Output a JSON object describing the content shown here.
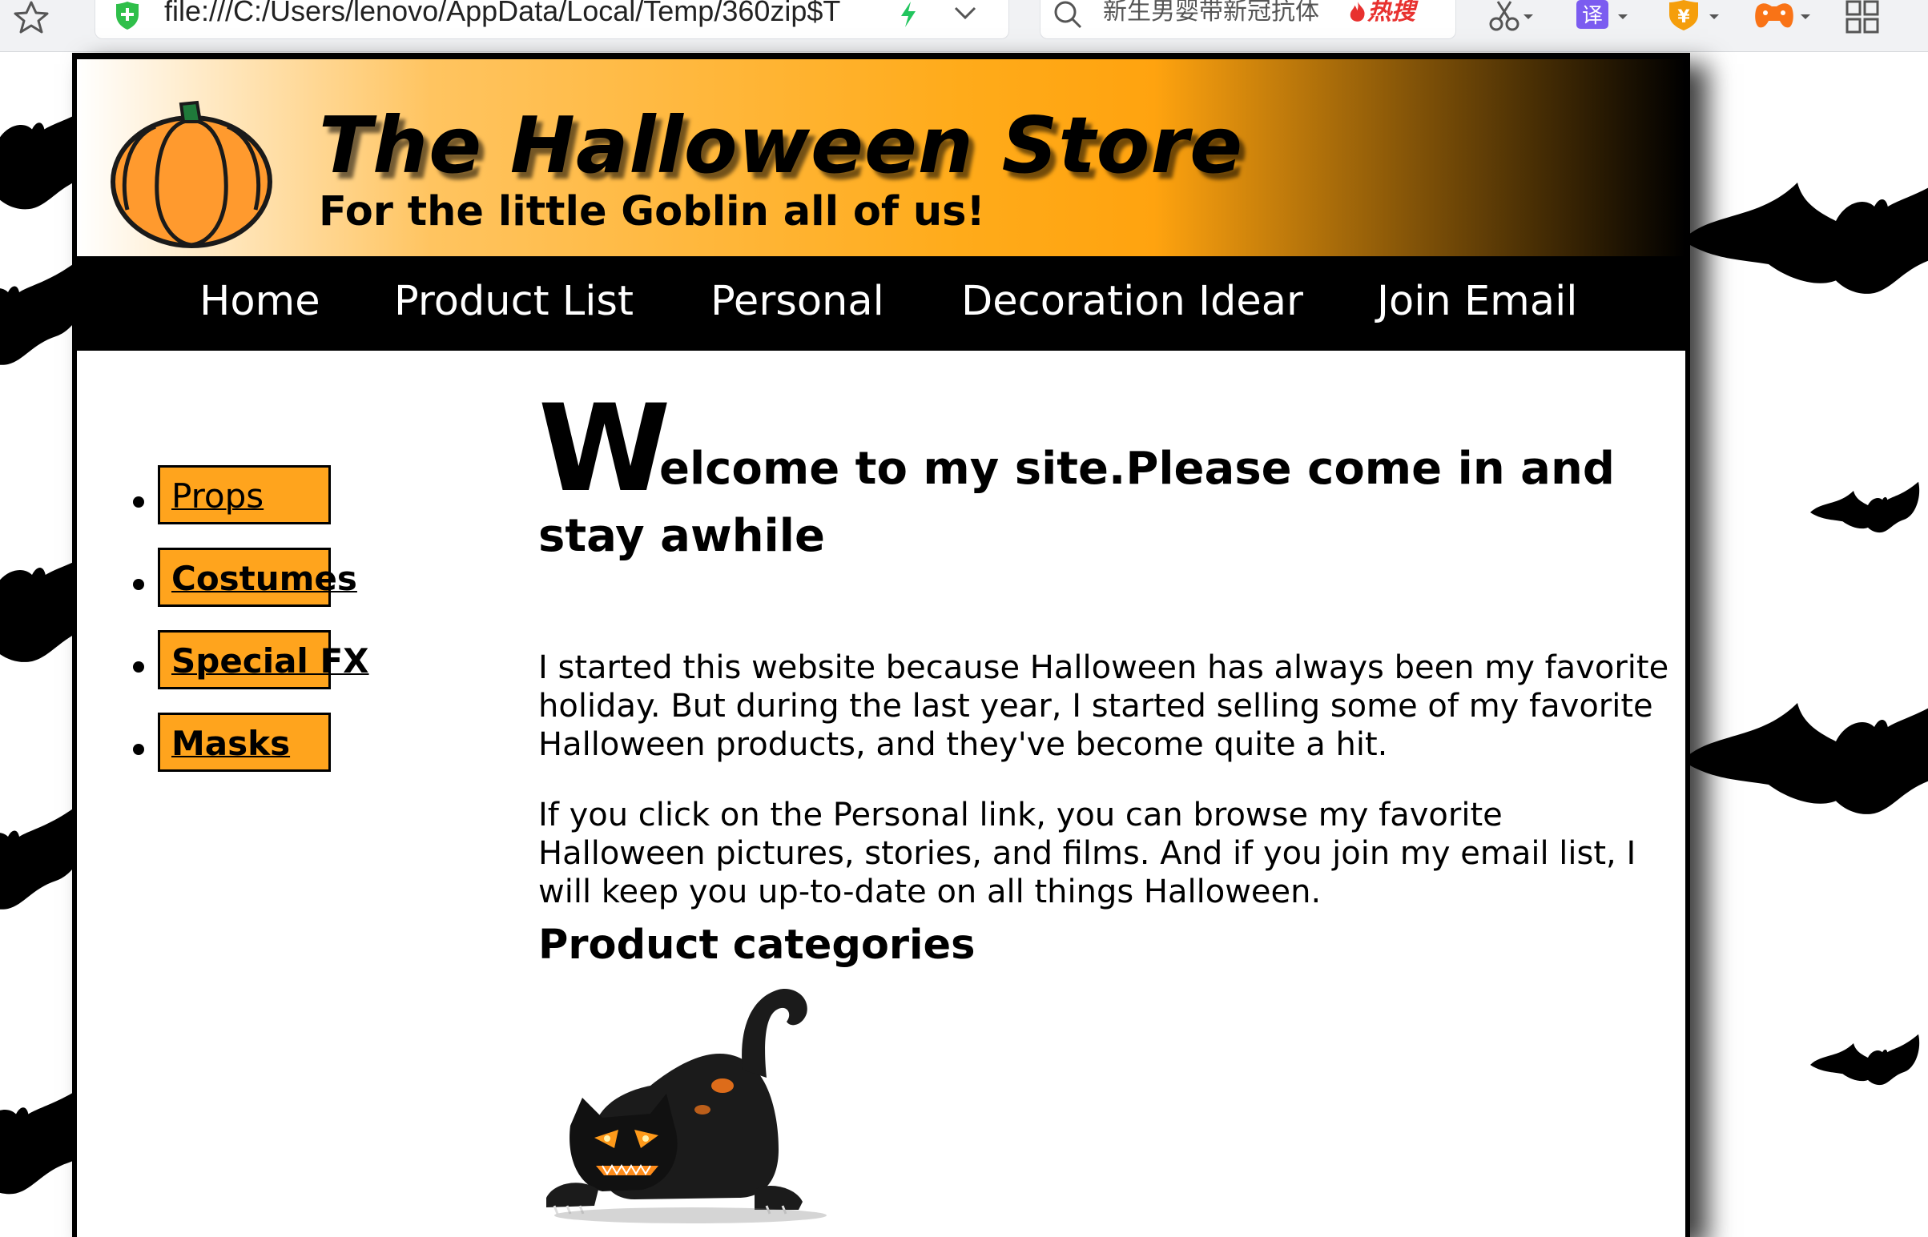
{
  "browser": {
    "url": "file:///C:/Users/lenovo/AppData/Local/Temp/360zip$T",
    "search_placeholder": "新生男婴带新冠抗体",
    "search_hot": "热搜",
    "translate_icon_text": "译",
    "yen_icon_text": "¥"
  },
  "header": {
    "title": "The Halloween Store",
    "tagline": "For the little Goblin all of us!"
  },
  "nav": {
    "items": [
      "Home",
      "Product List",
      "Personal",
      "Decoration Idear",
      "Join Email"
    ]
  },
  "sidebar": {
    "items": [
      {
        "label": "Props",
        "bold": false
      },
      {
        "label": "Costumes",
        "bold": true
      },
      {
        "label": "Special FX",
        "bold": true
      },
      {
        "label": "Masks",
        "bold": true
      }
    ]
  },
  "main": {
    "welcome_dropcap": "W",
    "welcome_rest": "elcome to my site.Please come in and",
    "welcome_line2": "stay awhile",
    "para1_lines": [
      "I started this website because Halloween has always been my favorite",
      "holiday. But during the last year, I started selling some of my favorite",
      "Halloween products, and they've become quite a hit."
    ],
    "para2_lines": [
      "If you click on the Personal link, you can browse my favorite",
      "Halloween pictures, stories, and films. And if you join my email list, I",
      "will keep you up-to-date on all things Halloween."
    ],
    "categories_heading": "Product categories"
  },
  "colors": {
    "accent_orange": "#ffa41d",
    "nav_bg": "#000000",
    "hot_red": "#e8312f"
  }
}
